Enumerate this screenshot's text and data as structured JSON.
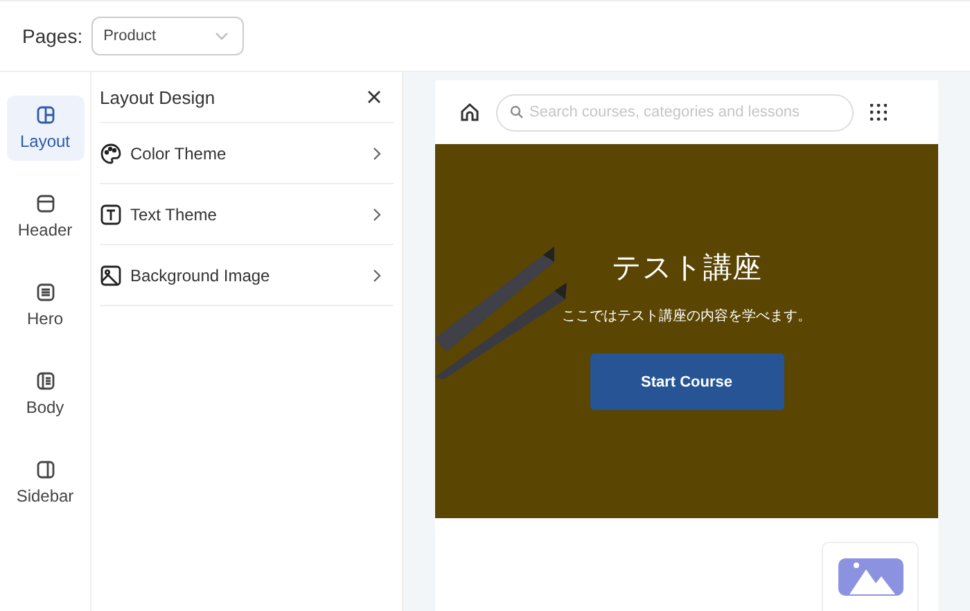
{
  "pages_selector": {
    "label": "Pages:",
    "value": "Product"
  },
  "nav": [
    {
      "label": "Layout",
      "selected": true
    },
    {
      "label": "Header",
      "selected": false
    },
    {
      "label": "Hero",
      "selected": false
    },
    {
      "label": "Body",
      "selected": false
    },
    {
      "label": "Sidebar",
      "selected": false
    }
  ],
  "panel": {
    "title": "Layout Design",
    "items": [
      {
        "label": "Color Theme"
      },
      {
        "label": "Text Theme"
      },
      {
        "label": "Background Image"
      }
    ]
  },
  "preview": {
    "search": {
      "placeholder": "Search courses, categories and lessons"
    },
    "hero": {
      "title": "テスト講座",
      "subtitle": "ここではテスト講座の内容を学べます。",
      "button": "Start Course"
    }
  }
}
